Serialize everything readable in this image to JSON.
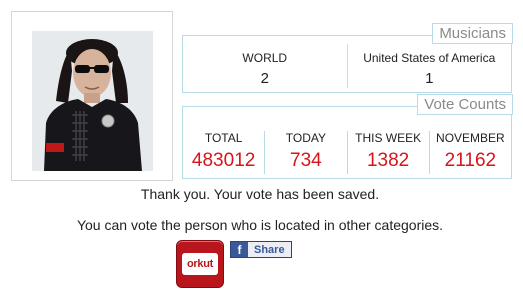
{
  "musicians": {
    "title": "Musicians",
    "world": {
      "label": "WORLD",
      "value": "2"
    },
    "country": {
      "label": "United States of America",
      "value": "1"
    }
  },
  "votes": {
    "title": "Vote Counts",
    "columns": [
      {
        "label": "TOTAL",
        "value": "483012"
      },
      {
        "label": "TODAY",
        "value": "734"
      },
      {
        "label": "THIS WEEK",
        "value": "1382"
      },
      {
        "label": "NOVEMBER",
        "value": "21162"
      }
    ]
  },
  "messages": {
    "saved": "Thank you. Your vote has been saved.",
    "other": "You can vote the person who is located in other categories."
  },
  "share": {
    "orkut_label": "orkut",
    "facebook_icon": "f",
    "facebook_label": "Share"
  },
  "colors": {
    "accent_border": "#b9dbe9",
    "vote_value": "#d8141b",
    "orkut": "#b8161c",
    "facebook": "#3b5998"
  }
}
